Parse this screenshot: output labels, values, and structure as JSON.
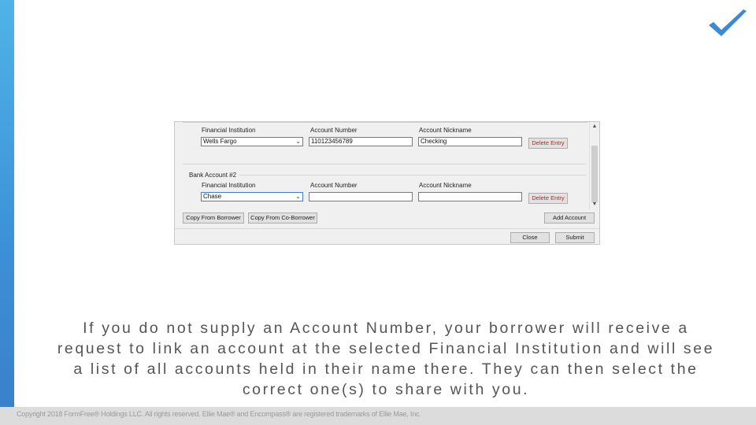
{
  "accounts": [
    {
      "header": "",
      "institution_label": "Financial Institution",
      "institution_value": "Wells Fargo",
      "account_number_label": "Account Number",
      "account_number_value": "110123456789",
      "nickname_label": "Account Nickname",
      "nickname_value": "Checking",
      "delete_label": "Delete Entry"
    },
    {
      "header": "Bank Account #2",
      "institution_label": "Financial Institution",
      "institution_value": "Chase",
      "account_number_label": "Account Number",
      "account_number_value": "",
      "nickname_label": "Account Nickname",
      "nickname_value": "",
      "delete_label": "Delete Entry"
    }
  ],
  "buttons": {
    "copy_borrower": "Copy From Borrower",
    "copy_coborrower": "Copy From Co-Borrower",
    "add_account": "Add Account",
    "close": "Close",
    "submit": "Submit"
  },
  "caption": "If you do not supply an Account Number, your borrower will receive a request to link an account at the selected Financial Institution and will see a list of all accounts held in their name there. They can then select the correct one(s) to share with you.",
  "footer": "Copyright 2018 FormFree® Holdings LLC. All rights reserved. Ellie Mae® and Encompass® are registered trademarks of Ellie Mae, Inc.",
  "colors": {
    "accent_bar": "#3c8fd6",
    "logo_check": "#3a8ad4",
    "delete_text": "#d01c1c"
  },
  "icons": {
    "logo": "checkmark-logo-icon",
    "dropdown": "chevron-down-icon"
  }
}
